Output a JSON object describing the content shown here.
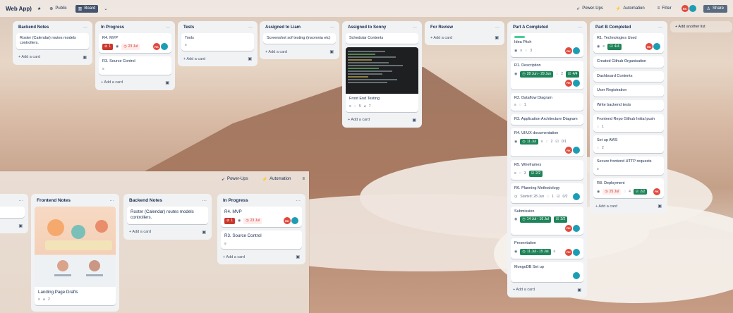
{
  "header": {
    "board_title": "Web App)",
    "visibility": "Public",
    "view_label": "Board",
    "power_ups": "Power-Ups",
    "automation": "Automation",
    "filter": "Filter",
    "share": "Share",
    "avatar_initials": "RK"
  },
  "lists": [
    {
      "title": "Backend Notes",
      "cards": [
        {
          "text": "Roster (Calendar) routes models controllers."
        }
      ],
      "add_label": "+ Add a card"
    },
    {
      "title": "In Progress",
      "cards": [
        {
          "text": "R4. MVP",
          "badge_count": "1",
          "date": "23 Jul"
        },
        {
          "text": "R3. Source Control"
        }
      ],
      "add_label": "+ Add a card"
    },
    {
      "title": "Tests",
      "cards": [
        {
          "text": "Tools"
        }
      ],
      "add_label": "+ Add a card"
    },
    {
      "title": "Assigned to Liam",
      "cards": [
        {
          "text": "Screenshot sof testing (insomnia etc)"
        }
      ],
      "add_label": "+ Add a card"
    },
    {
      "title": "Assigned to Sonny",
      "cards": [
        {
          "text": "Schedular Contents"
        },
        {
          "text": "Front End Testing",
          "comments": "5",
          "attachments": "7"
        }
      ],
      "add_label": "+ Add a card"
    },
    {
      "title": "For Review",
      "cards": [],
      "add_label": "+ Add a card"
    },
    {
      "title": "Part A Completed",
      "cards": [
        {
          "text": "Idea Pitch",
          "comments": "3"
        },
        {
          "text": "R1. Description",
          "date": "28 Jun - 29 Jun",
          "comments": "2",
          "checklist": "4/4"
        },
        {
          "text": "R2. Dataflow Diagram",
          "comments": "1"
        },
        {
          "text": "R3. Application Architecture Diagram"
        },
        {
          "text": "R4. UI/UX documentation",
          "date": "11 Jul",
          "comments": "2",
          "checklist": "0/1"
        },
        {
          "text": "R5. Wireframes",
          "comments": "3",
          "checklist": "2/2"
        },
        {
          "text": "R6. Planning Methodology",
          "date": "Started: 28 Jun",
          "comments": "1",
          "checklist": "0/2"
        },
        {
          "text": "Submission",
          "date": "14 Jul - 16 Jul",
          "checklist": "2/2"
        },
        {
          "text": "Presentation",
          "date": "11 Jul - 15 Jul"
        },
        {
          "text": "MongoDB Set up"
        }
      ],
      "add_label": "+ Add a card"
    },
    {
      "title": "Part B Completed",
      "cards": [
        {
          "text": "R1. Technologies Used",
          "checklist": "4/4"
        },
        {
          "text": "Created Github Organisation"
        },
        {
          "text": "Dashboard Contents"
        },
        {
          "text": "User Registration"
        },
        {
          "text": "Write backend tests"
        },
        {
          "text": "Frontend Repo Github Initial push",
          "comments": "1"
        },
        {
          "text": "Set up AWS",
          "comments": "2"
        },
        {
          "text": "Secure frontend HTTP requests"
        },
        {
          "text": "R8. Deployment",
          "date": "25 Jul",
          "comments": "4",
          "checklist": "2/2"
        }
      ],
      "add_label": "+ Add a card"
    }
  ],
  "add_list": "+ Add another list",
  "overlay": {
    "power_ups": "Power-Ups",
    "automation": "Automation",
    "lists": [
      {
        "title": "Frontend Notes",
        "cards": [
          {
            "text": "Landing Page Drafts",
            "attachments": "2"
          }
        ]
      },
      {
        "title": "Backend Notes",
        "cards": [
          {
            "text": "Roster (Calendar) routes models controllers."
          }
        ],
        "add_label": "+ Add a card"
      },
      {
        "title": "In Progress",
        "cards": [
          {
            "text": "R4. MVP",
            "badge_count": "1",
            "date": "23 Jul"
          },
          {
            "text": "R3. Source Control"
          }
        ],
        "add_label": "+ Add a card"
      }
    ]
  },
  "colors": {
    "green_badge": "#1f845a",
    "red_badge": "#c9372c",
    "avatar_red": "#e2483d",
    "avatar_teal": "#1d9db4"
  }
}
